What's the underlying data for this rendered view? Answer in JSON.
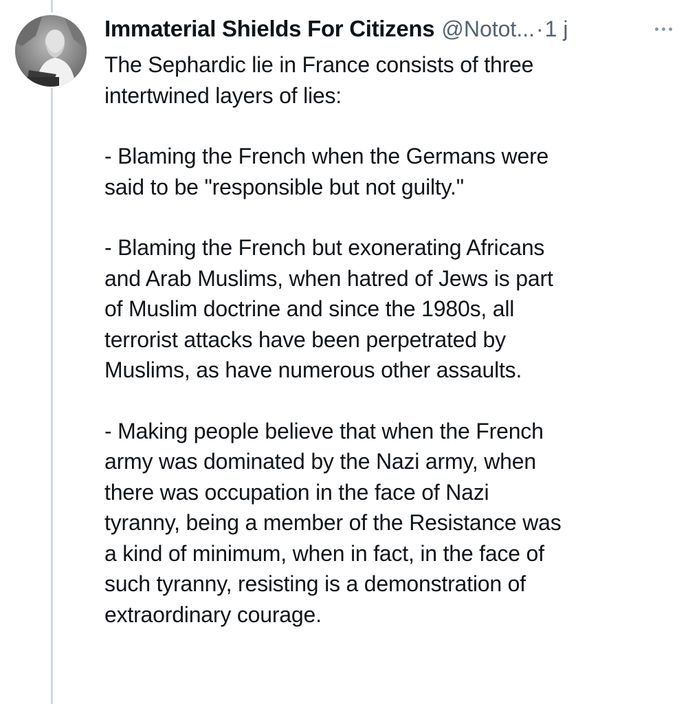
{
  "tweet": {
    "author": {
      "display_name": "Immaterial Shields For Citizens",
      "handle": "@Notot...",
      "avatar_icon": "avatar-photo"
    },
    "separator": "·",
    "time": "1 j",
    "more_icon": "more-horizontal-icon",
    "body": {
      "intro_line_1": "The Sephardic lie in France consists of three",
      "intro_line_2": "intertwined layers of lies:",
      "point1_line_1": "- Blaming the French when the Germans were",
      "point1_line_2": "said to be \"responsible but not guilty.\"",
      "point2_line_1": "- Blaming the French but exonerating Africans",
      "point2_line_2": "and Arab Muslims, when hatred of Jews is part",
      "point2_line_3": "of Muslim doctrine and since the 1980s, all",
      "point2_line_4": "terrorist attacks have been perpetrated by",
      "point2_line_5": "Muslims, as have numerous other assaults.",
      "point3_line_1": "- Making people believe that when the French",
      "point3_line_2": "army was dominated by the Nazi army, when",
      "point3_line_3": "there was occupation in the face of Nazi",
      "point3_line_4": "tyranny, being a member of the Resistance was",
      "point3_line_5": "a kind of minimum, when in fact, in the face of",
      "point3_line_6": "such tyranny, resisting is a demonstration of",
      "point3_line_7": "extraordinary courage."
    }
  },
  "colors": {
    "text": "#0f1419",
    "secondary": "#536471",
    "thread_line": "#cfd9de",
    "background": "#ffffff"
  }
}
